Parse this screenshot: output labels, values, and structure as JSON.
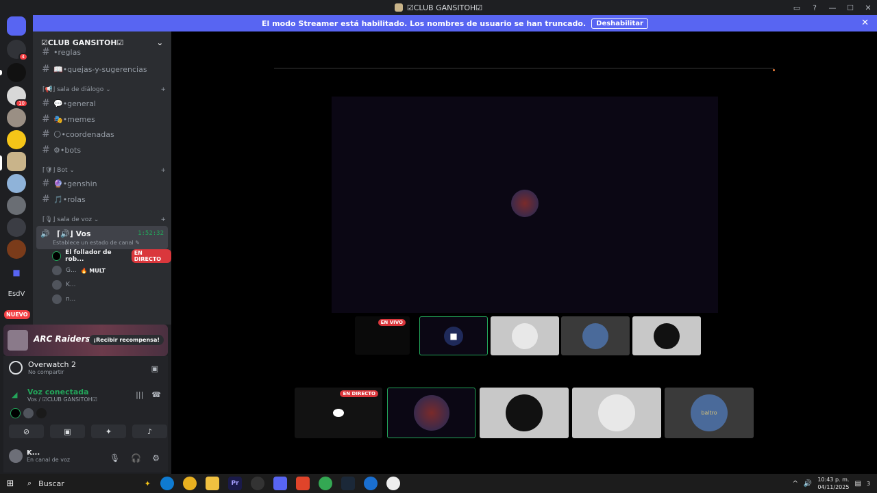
{
  "window": {
    "title": "☑CLUB GANSITOH☑",
    "controls": [
      "—",
      "☐",
      "✕"
    ]
  },
  "streamer_banner": {
    "text": "El modo Streamer está habilitado. Los nombres de usuario se han truncado.",
    "button": "Deshabilitar"
  },
  "servers": {
    "badges": [
      "4",
      "10"
    ],
    "esdv": "EsdV",
    "nuevo": "NUEVO"
  },
  "server_header": {
    "name": "☑CLUB GANSITOH☑"
  },
  "channels": [
    {
      "name": "•reglas"
    },
    {
      "name": "📖•quejas-y-sugerencias"
    },
    {
      "name": "💬•general"
    },
    {
      "name": "🎭•memes"
    },
    {
      "name": "🌕•coordenadas"
    },
    {
      "name": "⚙•bots"
    },
    {
      "name": "🔮•genshin"
    },
    {
      "name": "🎵•rolas"
    }
  ],
  "categories": [
    {
      "name": "⌈📢⌋ sala de diálogo ⌄"
    },
    {
      "name": "⌈🛡⌋ Bot ⌄"
    },
    {
      "name": "⌈🎙⌋ sala de voz ⌄"
    }
  ],
  "voice_channel": {
    "name": "⌈🔊⌋ Vos",
    "timer": "1:52:32",
    "status": "Establece un estado de canal ✎",
    "users": [
      {
        "name": "El follador de rob...",
        "tag": "EN DIRECTO"
      },
      {
        "name": "G...",
        "tag": "🔥 MULT"
      },
      {
        "name": "K..."
      },
      {
        "name": "n..."
      }
    ]
  },
  "promo": {
    "logo": "ARC Raiders",
    "cta": "¡Recibir recompensa!"
  },
  "activity": {
    "game": "Overwatch 2",
    "game_status": "No compartir"
  },
  "voice_connection": {
    "title": "Voz conectada",
    "subtitle": "Vos / ☑CLUB GANSITOH☑"
  },
  "user": {
    "name": "K...",
    "status": "En canal de voz"
  },
  "stage": {
    "thumb_live": "EN VIVO",
    "big_live": "EN DIRECTO",
    "tile_text": "baltro"
  },
  "taskbar": {
    "search": "Buscar",
    "time": "10:43 p. m.",
    "date": "04/11/2025",
    "notif": "3"
  }
}
